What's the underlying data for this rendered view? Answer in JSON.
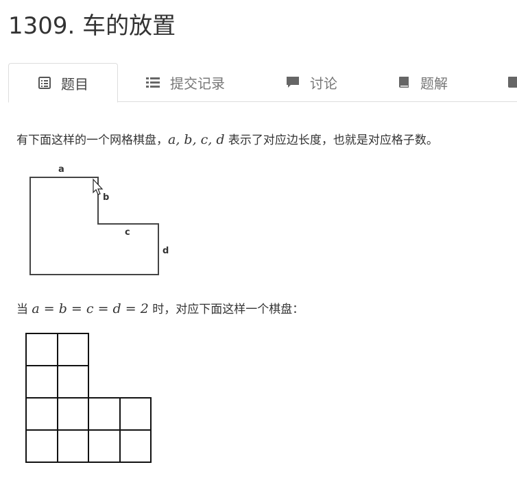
{
  "problem": {
    "title": "1309. 车的放置"
  },
  "tabs": [
    {
      "label": "题目",
      "icon": "document-icon",
      "active": true
    },
    {
      "label": "提交记录",
      "icon": "list-icon",
      "active": false
    },
    {
      "label": "讨论",
      "icon": "comment-icon",
      "active": false
    },
    {
      "label": "题解",
      "icon": "book-icon",
      "active": false
    }
  ],
  "description": {
    "intro_before": "有下面这样的一个网格棋盘，",
    "intro_math": "a, b, c, d",
    "intro_after": " 表示了对应边长度，也就是对应格子数。",
    "diagram_labels": {
      "a": "a",
      "b": "b",
      "c": "c",
      "d": "d"
    },
    "example_before": "当 ",
    "example_math": "a = b = c = d = 2",
    "example_after": " 时，对应下面这样一个棋盘："
  }
}
